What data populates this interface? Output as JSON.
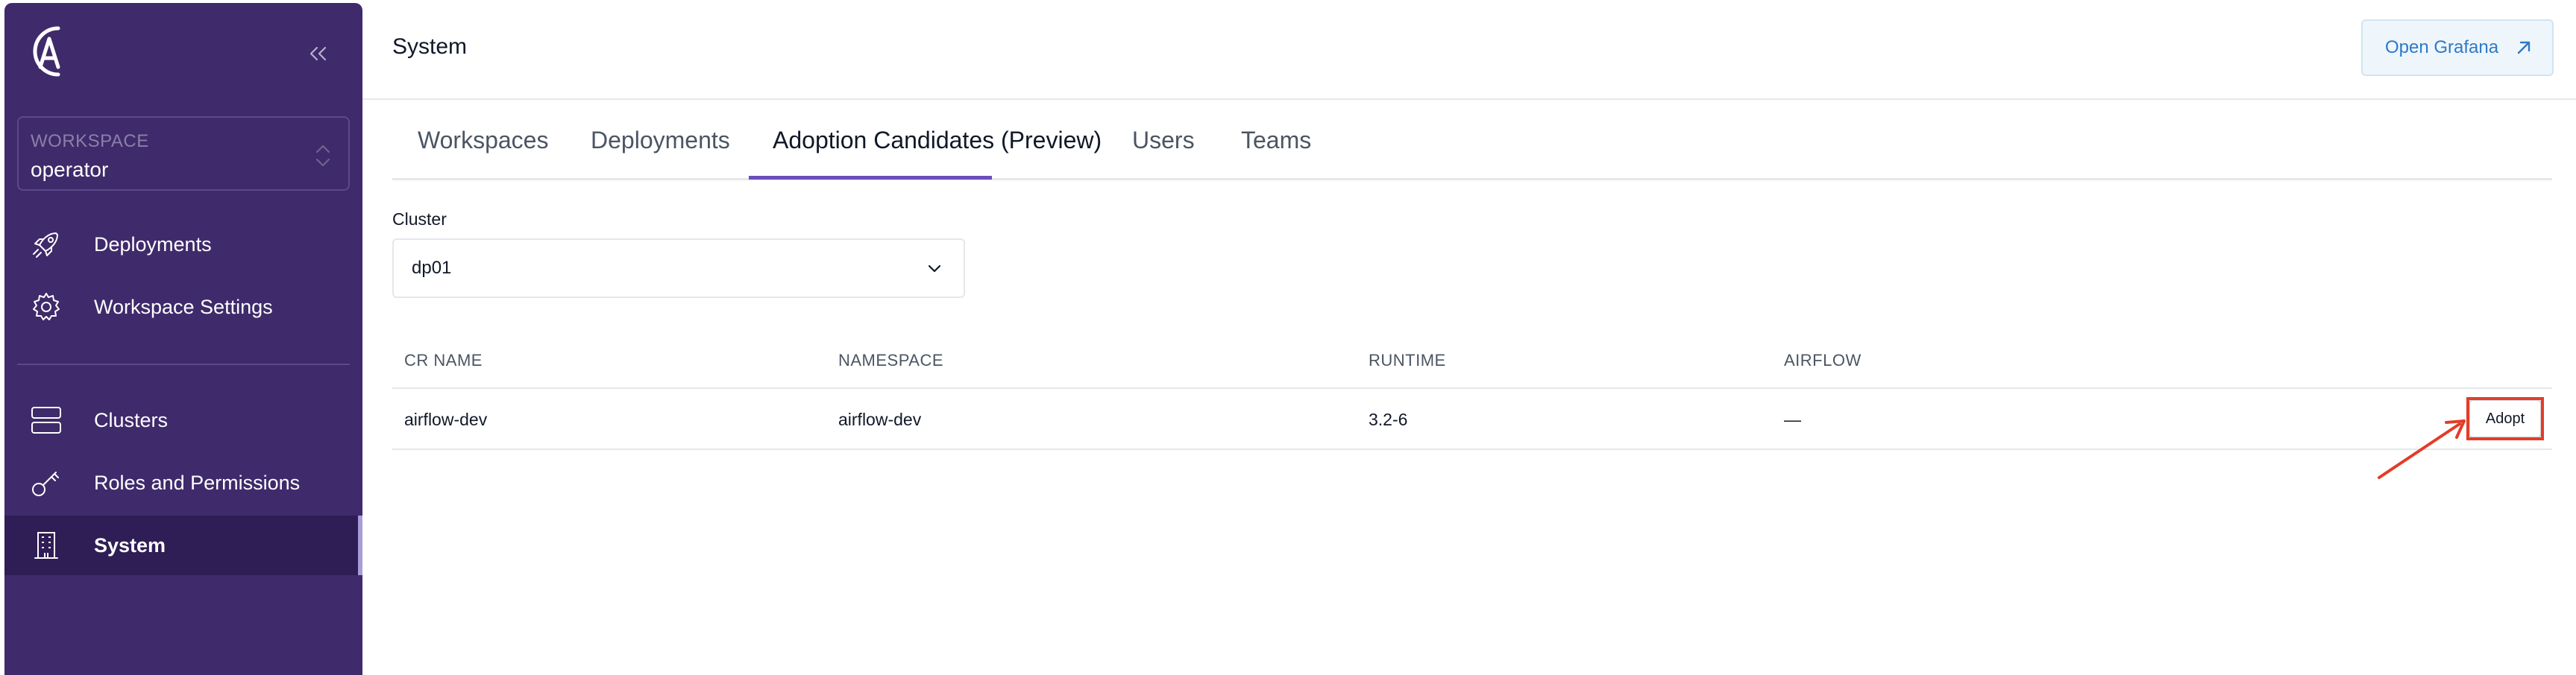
{
  "sidebar": {
    "workspace_caption": "WORKSPACE",
    "workspace_value": "operator",
    "items": [
      {
        "label": "Deployments",
        "icon": "rocket-icon"
      },
      {
        "label": "Workspace Settings",
        "icon": "gear-icon"
      },
      {
        "label": "Clusters",
        "icon": "clusters-icon"
      },
      {
        "label": "Roles and Permissions",
        "icon": "key-icon"
      },
      {
        "label": "System",
        "icon": "building-icon",
        "active": true
      }
    ]
  },
  "header": {
    "title": "System",
    "grafana_label": "Open Grafana"
  },
  "tabs": [
    {
      "label": "Workspaces"
    },
    {
      "label": "Deployments"
    },
    {
      "label": "Adoption Candidates (Preview)",
      "active": true
    },
    {
      "label": "Users"
    },
    {
      "label": "Teams"
    }
  ],
  "cluster": {
    "label": "Cluster",
    "selected": "dp01"
  },
  "table": {
    "columns": [
      "CR NAME",
      "NAMESPACE",
      "RUNTIME",
      "AIRFLOW"
    ],
    "rows": [
      {
        "cr_name": "airflow-dev",
        "namespace": "airflow-dev",
        "runtime": "3.2-6",
        "airflow": "—",
        "action": "Adopt"
      }
    ]
  },
  "colors": {
    "sidebar_bg": "#3f2a6b",
    "sidebar_active": "#2f1d55",
    "accent": "#6b4fbb",
    "grafana_text": "#2d79c7",
    "annotation": "#e23d28"
  }
}
